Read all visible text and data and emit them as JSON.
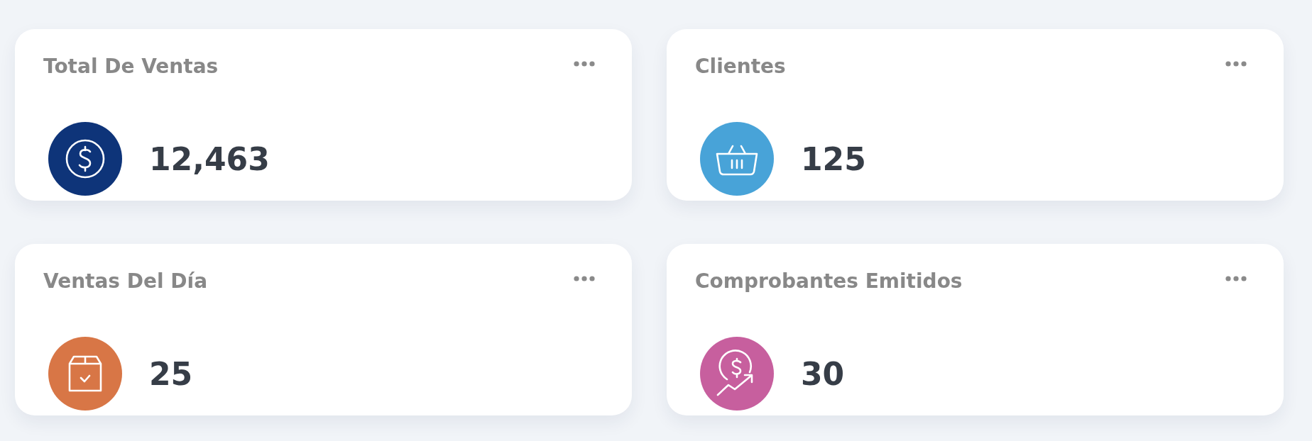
{
  "cards": [
    {
      "title": "Total De Ventas",
      "value": "12,463",
      "kind": "dollar",
      "color": "#0e3479"
    },
    {
      "title": "Clientes",
      "value": "125",
      "kind": "basket",
      "color": "#48a3d8"
    },
    {
      "title": "Ventas Del Día",
      "value": "25",
      "kind": "box",
      "color": "#d87646"
    },
    {
      "title": "Comprobantes Emitidos",
      "value": "30",
      "kind": "growth",
      "color": "#c75f9e"
    }
  ]
}
